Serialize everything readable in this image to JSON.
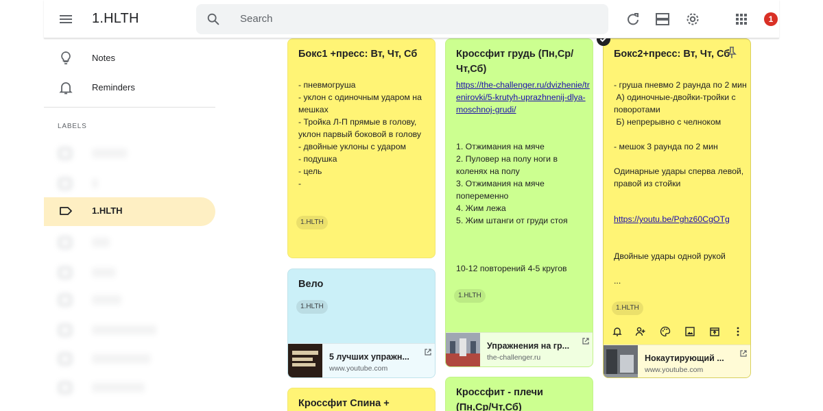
{
  "header": {
    "title": "1.HLTH",
    "search_placeholder": "Search",
    "notification_count": "1"
  },
  "sidebar": {
    "items": [
      {
        "label": "Notes",
        "icon": "lightbulb-icon"
      },
      {
        "label": "Reminders",
        "icon": "bell-icon"
      }
    ],
    "labels_heading": "LABELS",
    "labels": [
      {
        "label": "1.HLTH",
        "active": true
      }
    ]
  },
  "notes": [
    {
      "id": "box1",
      "color": "#fff475",
      "title": "Бокс1 +пресс: Вт, Чт, Сб",
      "body": "- пневмогруша\n- уклон с одиночным ударом на мешках\n- Тройка Л-П прямые в голову, уклон парвый боковой в голову\n- двойные уклоны с ударом\n- подушка\n- цель\n-",
      "label_chip": "1.HLTH"
    },
    {
      "id": "velo",
      "color": "#cbf0f8",
      "title": "Вело",
      "label_chip": "1.HLTH",
      "link": {
        "title": "5 лучших упражн...",
        "domain": "www.youtube.com"
      }
    },
    {
      "id": "crossfit-back",
      "color": "#fff475",
      "title": "Кроссфит Спина +"
    },
    {
      "id": "crossfit-chest",
      "color": "#ccff90",
      "title": "Кроссфит грудь (Пн,Ср/Чт,Сб)",
      "url": "https://the-challenger.ru/dvizhenie/trenirovki/5-krutyh-uprazhnenij-dlya-moschnoj-grudi/",
      "body": "1. Отжимания на мяче\n2. Пуловер на полу ноги в коленях на полу\n3. Отжимания на мяче попеременно\n4. Жим лежа\n5. Жим штанги от груди стоя",
      "footer_text": "10-12 повторений 4-5 кругов",
      "label_chip": "1.HLTH",
      "link": {
        "title": "Упражнения на гр...",
        "domain": "the-challenger.ru"
      }
    },
    {
      "id": "crossfit-shoulders",
      "color": "#ccff90",
      "title": "Кроссфит - плечи (Пн,Ср/Чт,Сб)"
    },
    {
      "id": "box2",
      "color": "#fff475",
      "title": "Бокс2+пресс: Вт, Чт, Сб",
      "body": "- груша пневмо 2 раунда по 2 мин\n А) одиночные-двойки-тройки с поворотами\n Б) непрерывно с челноком\n\n- мешок 3 раунда по 2 мин\n\nОдинарные удары сперва левой, правой из стойки",
      "url": "https://youtu.be/Pghz60CgOTg",
      "body2": "Двойные удары одной рукой\n\n...",
      "label_chip": "1.HLTH",
      "link": {
        "title": "Нокаутирующий ...",
        "domain": "www.youtube.com"
      }
    }
  ]
}
